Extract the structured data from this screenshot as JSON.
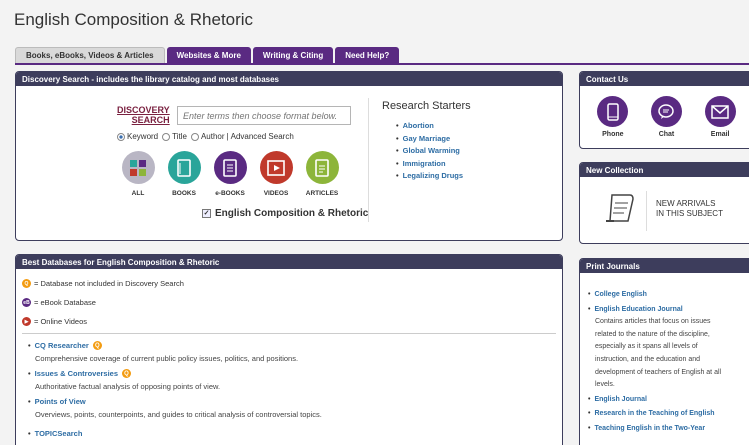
{
  "page": {
    "title": "English Composition & Rhetoric"
  },
  "tabs": [
    {
      "label": "Books, eBooks, Videos & Articles"
    },
    {
      "label": "Websites & More"
    },
    {
      "label": "Writing & Citing"
    },
    {
      "label": "Need Help?"
    }
  ],
  "discovery": {
    "header": "Discovery Search - includes the library catalog and most databases",
    "logo_line1": "DISCOVERY",
    "logo_line2": "SEARCH",
    "search_placeholder": "Enter terms then choose format below.",
    "options": {
      "keyword": "Keyword",
      "title": "Title",
      "author": "Author",
      "sep": "|",
      "advanced": "Advanced Search"
    },
    "formats": [
      {
        "label": "ALL",
        "color": "#b9b6c4"
      },
      {
        "label": "BOOKS",
        "color": "#2aa59a"
      },
      {
        "label": "e-BOOKS",
        "color": "#5a2a82"
      },
      {
        "label": "VIDEOS",
        "color": "#c0392b"
      },
      {
        "label": "ARTICLES",
        "color": "#8db53a"
      }
    ],
    "scope_label": "English Composition & Rhetoric",
    "starters_title": "Research Starters",
    "starters": [
      "Abortion",
      "Gay Marriage",
      "Global Warming",
      "Immigration",
      "Legalizing Drugs"
    ]
  },
  "best": {
    "header": "Best Databases for English Composition & Rhetoric",
    "legend": [
      {
        "text": "= Database not included in Discovery Search",
        "color": "#f39c12",
        "icon": "search-icon"
      },
      {
        "text": "= eBook Database",
        "color": "#5a2a82",
        "icon": "ebook-icon"
      },
      {
        "text": "= Online Videos",
        "color": "#c0392b",
        "icon": "play-icon"
      }
    ],
    "databases": [
      {
        "name": "CQ Researcher",
        "desc": "Comprehensive coverage of current public policy issues, politics, and positions."
      },
      {
        "name": "Issues & Controversies",
        "desc": "Authoritative factual analysis of opposing points of view."
      },
      {
        "name": "Points of View",
        "desc": "Overviews, points, counterpoints, and guides to critical analysis of controversial topics."
      },
      {
        "name": "TOPICSearch",
        "desc": ""
      }
    ]
  },
  "contact": {
    "header": "Contact Us",
    "items": [
      {
        "label": "Phone"
      },
      {
        "label": "Chat"
      },
      {
        "label": "Email"
      }
    ]
  },
  "newcoll": {
    "header": "New Collection",
    "line1": "NEW ARRIVALS",
    "line2": "IN THIS SUBJECT"
  },
  "journals": {
    "header": "Print Journals",
    "items": [
      {
        "name": "College English"
      },
      {
        "name": "English Education Journal"
      },
      {
        "name": "English Journal"
      },
      {
        "name": "Research in the Teaching of English"
      },
      {
        "name": "Teaching English in the Two-Year"
      }
    ],
    "desc_lines": [
      "Contains articles that focus on issues",
      "related to the nature of the discipline,",
      "especially as it spans all levels of",
      "instruction, and the education and",
      "development of teachers of English at all",
      "levels."
    ]
  }
}
